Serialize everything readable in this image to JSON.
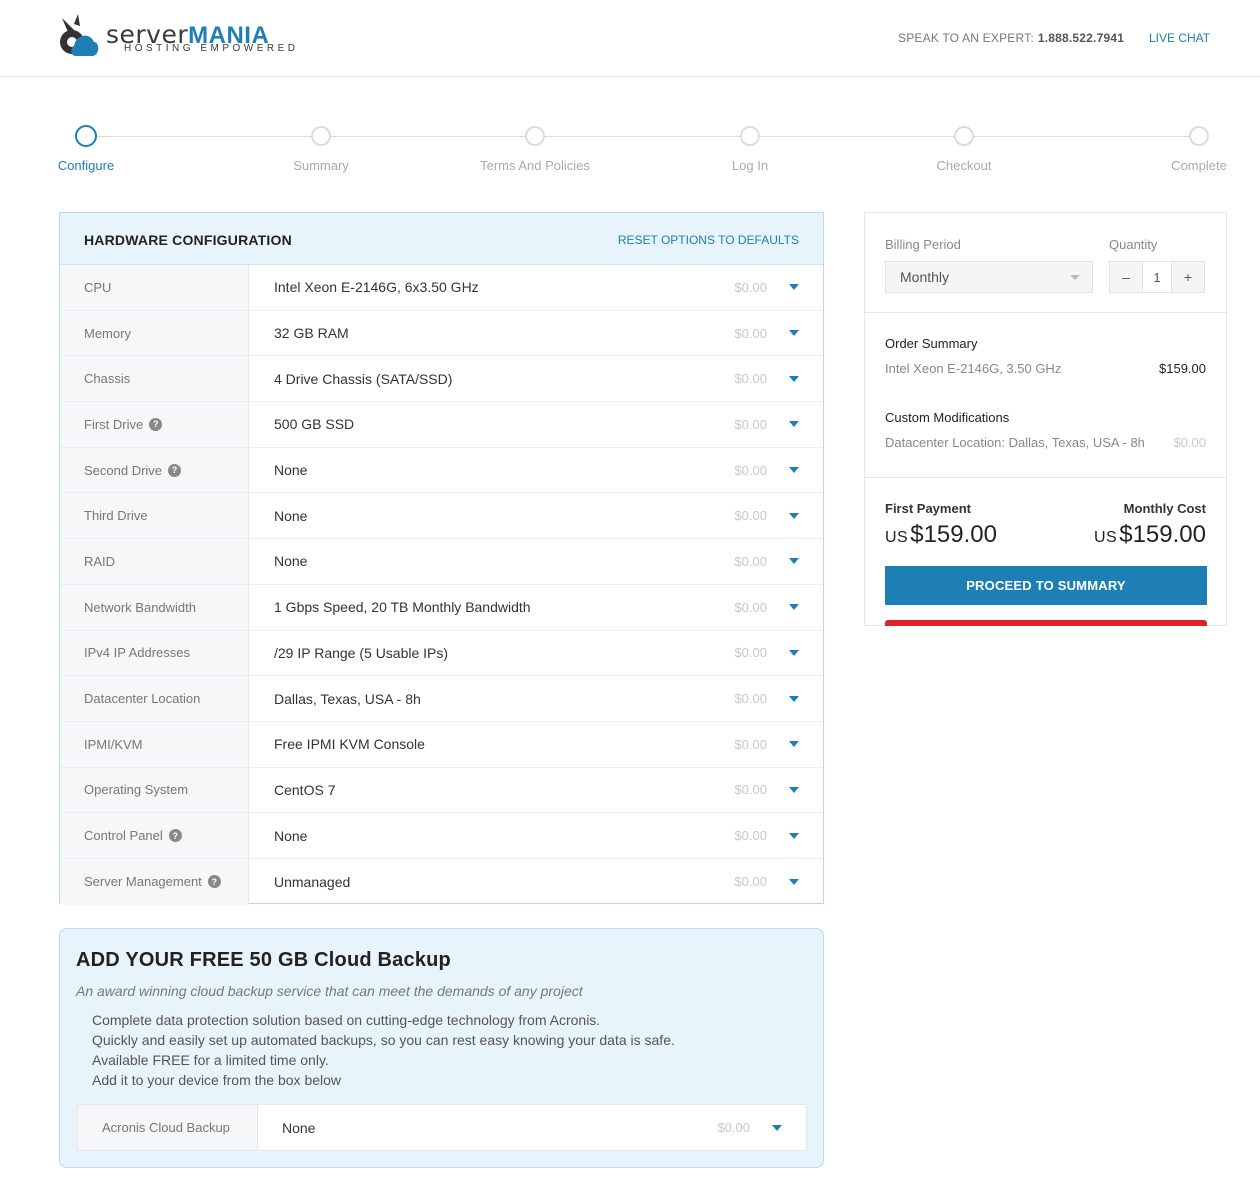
{
  "brand": {
    "name_part1": "server",
    "name_part2": "MANIA",
    "tagline": "HOSTING EMPOWERED",
    "accent_color": "#1d7fb3"
  },
  "header": {
    "speak_label": "SPEAK TO AN EXPERT:",
    "phone": "1.888.522.7941",
    "live_chat": "LIVE CHAT"
  },
  "steps": [
    {
      "label": "Configure",
      "active": true
    },
    {
      "label": "Summary",
      "active": false
    },
    {
      "label": "Terms And Policies",
      "active": false
    },
    {
      "label": "Log In",
      "active": false
    },
    {
      "label": "Checkout",
      "active": false
    },
    {
      "label": "Complete",
      "active": false
    }
  ],
  "hardware": {
    "title": "HARDWARE CONFIGURATION",
    "reset": "RESET OPTIONS TO DEFAULTS",
    "rows": [
      {
        "label": "CPU",
        "value": "Intel Xeon E-2146G, 6x3.50 GHz",
        "price": "$0.00",
        "help": false
      },
      {
        "label": "Memory",
        "value": "32 GB RAM",
        "price": "$0.00",
        "help": false
      },
      {
        "label": "Chassis",
        "value": "4 Drive Chassis (SATA/SSD)",
        "price": "$0.00",
        "help": false
      },
      {
        "label": "First Drive",
        "value": "500 GB SSD",
        "price": "$0.00",
        "help": true
      },
      {
        "label": "Second Drive",
        "value": "None",
        "price": "$0.00",
        "help": true
      },
      {
        "label": "Third Drive",
        "value": "None",
        "price": "$0.00",
        "help": false
      },
      {
        "label": "RAID",
        "value": "None",
        "price": "$0.00",
        "help": false
      },
      {
        "label": "Network Bandwidth",
        "value": "1 Gbps Speed, 20 TB Monthly Bandwidth",
        "price": "$0.00",
        "help": false
      },
      {
        "label": "IPv4 IP Addresses",
        "value": "/29 IP Range (5 Usable IPs)",
        "price": "$0.00",
        "help": false
      },
      {
        "label": "Datacenter Location",
        "value": "Dallas, Texas, USA - 8h",
        "price": "$0.00",
        "help": false
      },
      {
        "label": "IPMI/KVM",
        "value": "Free IPMI KVM Console",
        "price": "$0.00",
        "help": false
      },
      {
        "label": "Operating System",
        "value": "CentOS 7",
        "price": "$0.00",
        "help": false
      },
      {
        "label": "Control Panel",
        "value": "None",
        "price": "$0.00",
        "help": true
      },
      {
        "label": "Server Management",
        "value": "Unmanaged",
        "price": "$0.00",
        "help": true
      }
    ]
  },
  "cloud_backup": {
    "title": "ADD YOUR FREE 50 GB Cloud Backup",
    "subtitle": "An award winning cloud backup service that can meet the demands of any project",
    "lines": [
      "Complete data protection solution based on cutting-edge technology from Acronis.",
      "Quickly and easily set up automated backups, so you can rest easy knowing your data is safe.",
      "Available FREE for a limited time only.",
      "Add it to your device from the box below"
    ],
    "row": {
      "label": "Acronis Cloud Backup",
      "value": "None",
      "price": "$0.00"
    }
  },
  "order": {
    "billing_label": "Billing Period",
    "billing_value": "Monthly",
    "quantity_label": "Quantity",
    "quantity_minus": "–",
    "quantity_value": "1",
    "quantity_plus": "+",
    "summary_title": "Order Summary",
    "summary_item": "Intel Xeon E-2146G, 3.50 GHz",
    "summary_price": "$159.00",
    "custom_title": "Custom Modifications",
    "custom_item": "Datacenter Location: Dallas, Texas, USA - 8h",
    "custom_price": "$0.00",
    "first_payment_label": "First Payment",
    "first_payment_currency": "US",
    "first_payment_amount": "$159.00",
    "monthly_cost_label": "Monthly Cost",
    "monthly_cost_currency": "US",
    "monthly_cost_amount": "$159.00",
    "proceed": "PROCEED TO SUMMARY"
  }
}
